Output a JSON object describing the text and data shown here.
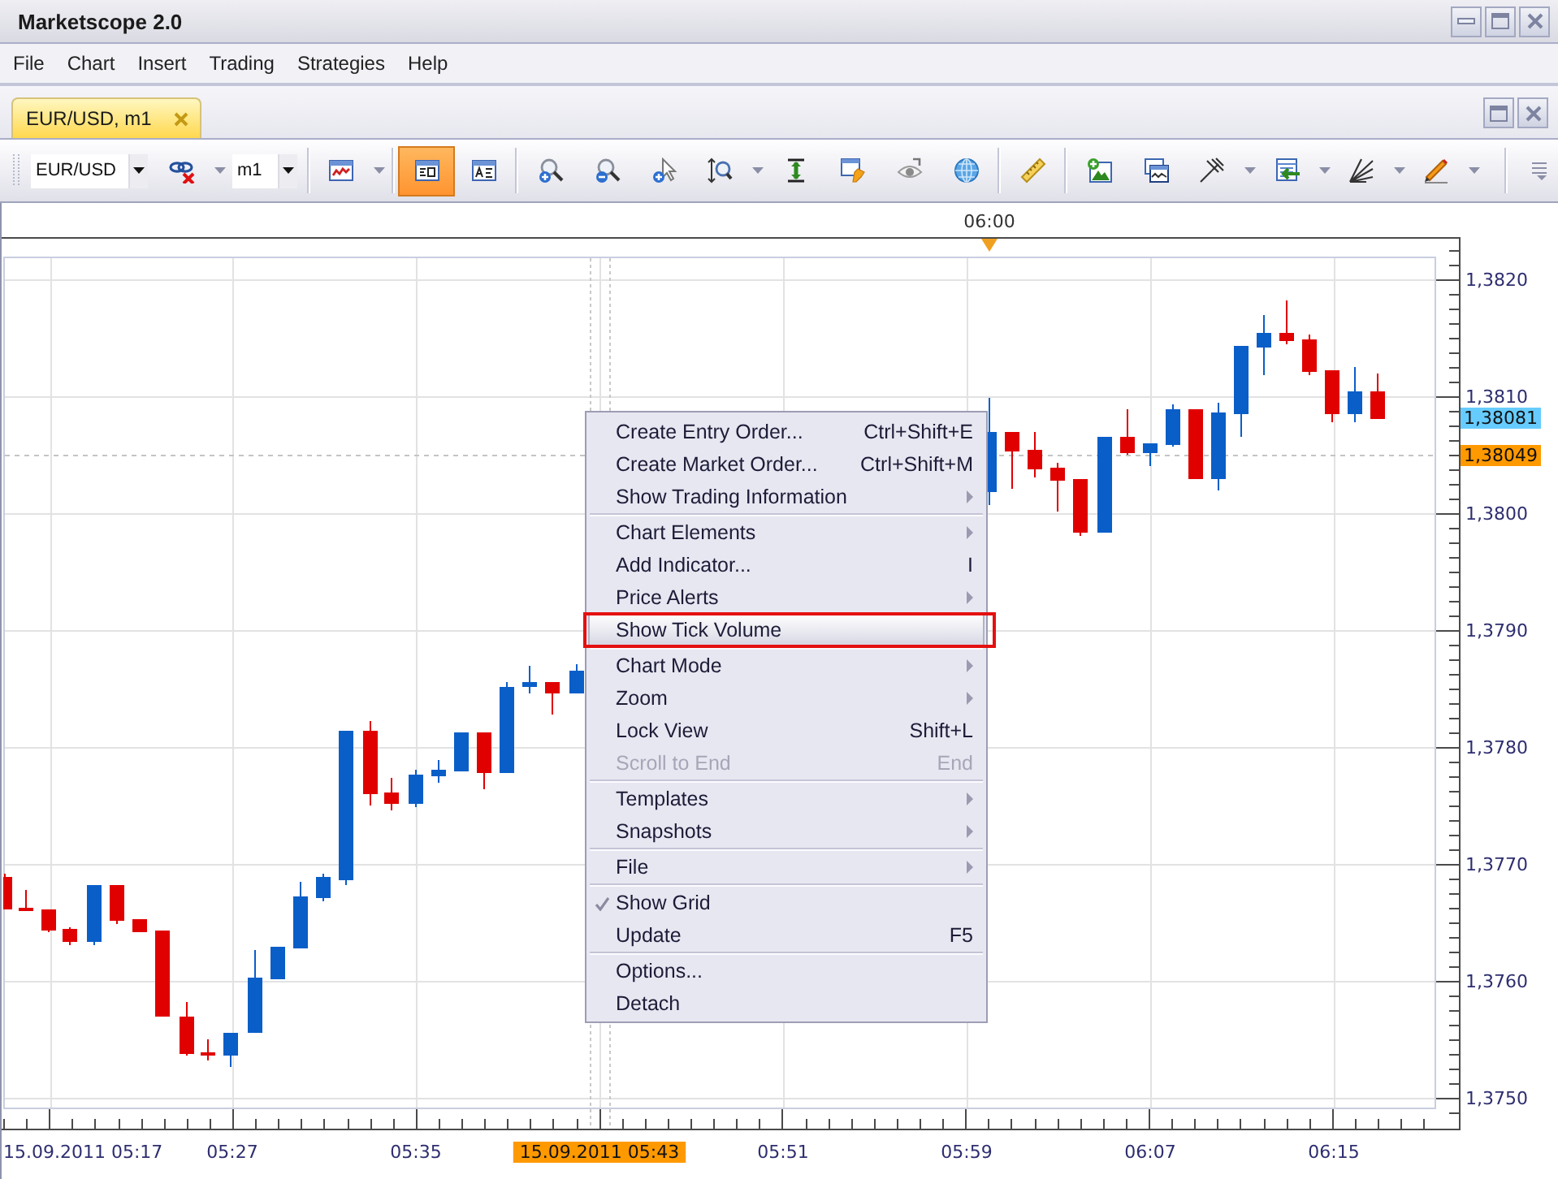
{
  "window": {
    "title": "Marketscope 2.0"
  },
  "menu_bar": [
    "File",
    "Chart",
    "Insert",
    "Trading",
    "Strategies",
    "Help"
  ],
  "tabs": [
    {
      "label": "EUR/USD, m1",
      "selected": true
    }
  ],
  "toolbar": {
    "symbol": "EUR/USD",
    "link_button": {
      "dropdown": true
    },
    "timeframe": "m1",
    "groups": [
      [
        {
          "active": false,
          "dropdown": true
        }
      ],
      [
        {
          "active": true,
          "dropdown": false
        },
        {
          "active": false,
          "dropdown": false
        }
      ],
      [
        {
          "active": false,
          "dropdown": false
        },
        {
          "active": false,
          "dropdown": false
        },
        {
          "active": false,
          "dropdown": false
        },
        {
          "active": false,
          "dropdown": true
        },
        {
          "active": false,
          "dropdown": false
        },
        {
          "active": false,
          "dropdown": false
        },
        {
          "active": false,
          "dropdown": false
        },
        {
          "active": false,
          "dropdown": false
        }
      ],
      [
        {
          "active": false,
          "dropdown": false
        }
      ],
      [
        {
          "active": false,
          "dropdown": false
        },
        {
          "active": false,
          "dropdown": false
        },
        {
          "active": false,
          "dropdown": true
        },
        {
          "active": false,
          "dropdown": true
        },
        {
          "active": false,
          "dropdown": true
        },
        {
          "active": false,
          "dropdown": true
        }
      ]
    ]
  },
  "chart": {
    "cursor_time": "06:00",
    "price_labels": [
      "1,3820",
      "1,3810",
      "1,3800",
      "1,3790",
      "1,3780",
      "1,3770",
      "1,3760",
      "1,3750"
    ],
    "price_tags": [
      {
        "text": "1,38081",
        "color": "#66ccff"
      },
      {
        "text": "1,38049",
        "color": "#ff9900"
      }
    ],
    "time_labels": [
      {
        "text": "15.09.2011 05:17",
        "selected": false
      },
      {
        "text": "05:27",
        "selected": false
      },
      {
        "text": "05:35",
        "selected": false
      },
      {
        "text": "15.09.2011 05:43",
        "selected": true
      },
      {
        "text": "05:51",
        "selected": false
      },
      {
        "text": "05:59",
        "selected": false
      },
      {
        "text": "06:07",
        "selected": false
      },
      {
        "text": "06:15",
        "selected": false
      }
    ]
  },
  "context_menu": {
    "groups": [
      [
        {
          "label": "Create Entry Order...",
          "shortcut": "Ctrl+Shift+E",
          "submenu": false,
          "checked": false,
          "disabled": false,
          "selected": false,
          "outlined": false
        },
        {
          "label": "Create Market Order...",
          "shortcut": "Ctrl+Shift+M",
          "submenu": false,
          "checked": false,
          "disabled": false,
          "selected": false,
          "outlined": false
        },
        {
          "label": "Show Trading Information",
          "submenu": true,
          "checked": false,
          "disabled": false,
          "selected": false,
          "outlined": false
        }
      ],
      [
        {
          "label": "Chart Elements",
          "submenu": true,
          "checked": false,
          "disabled": false,
          "selected": false,
          "outlined": false
        },
        {
          "label": "Add Indicator...",
          "shortcut": "I",
          "submenu": false,
          "checked": false,
          "disabled": false,
          "selected": false,
          "outlined": false
        },
        {
          "label": "Price Alerts",
          "submenu": true,
          "checked": false,
          "disabled": false,
          "selected": false,
          "outlined": false
        },
        {
          "label": "Show Tick Volume",
          "submenu": false,
          "checked": false,
          "disabled": false,
          "selected": true,
          "outlined": true
        }
      ],
      [
        {
          "label": "Chart Mode",
          "submenu": true,
          "checked": false,
          "disabled": false,
          "selected": false,
          "outlined": false
        },
        {
          "label": "Zoom",
          "submenu": true,
          "checked": false,
          "disabled": false,
          "selected": false,
          "outlined": false
        },
        {
          "label": "Lock View",
          "shortcut": "Shift+L",
          "submenu": false,
          "checked": false,
          "disabled": false,
          "selected": false,
          "outlined": false
        },
        {
          "label": "Scroll to End",
          "shortcut": "End",
          "submenu": false,
          "checked": false,
          "disabled": true,
          "selected": false,
          "outlined": false
        }
      ],
      [
        {
          "label": "Templates",
          "submenu": true,
          "checked": false,
          "disabled": false,
          "selected": false,
          "outlined": false
        },
        {
          "label": "Snapshots",
          "submenu": true,
          "checked": false,
          "disabled": false,
          "selected": false,
          "outlined": false
        }
      ],
      [
        {
          "label": "File",
          "submenu": true,
          "checked": false,
          "disabled": false,
          "selected": false,
          "outlined": false
        }
      ],
      [
        {
          "label": "Show Grid",
          "submenu": false,
          "checked": true,
          "disabled": false,
          "selected": false,
          "outlined": false
        },
        {
          "label": "Update",
          "shortcut": "F5",
          "submenu": false,
          "checked": false,
          "disabled": false,
          "selected": false,
          "outlined": false
        }
      ],
      [
        {
          "label": "Options...",
          "submenu": false,
          "checked": false,
          "disabled": false,
          "selected": false,
          "outlined": false
        },
        {
          "label": "Detach",
          "submenu": false,
          "checked": false,
          "disabled": false,
          "selected": false,
          "outlined": false
        }
      ]
    ]
  }
}
